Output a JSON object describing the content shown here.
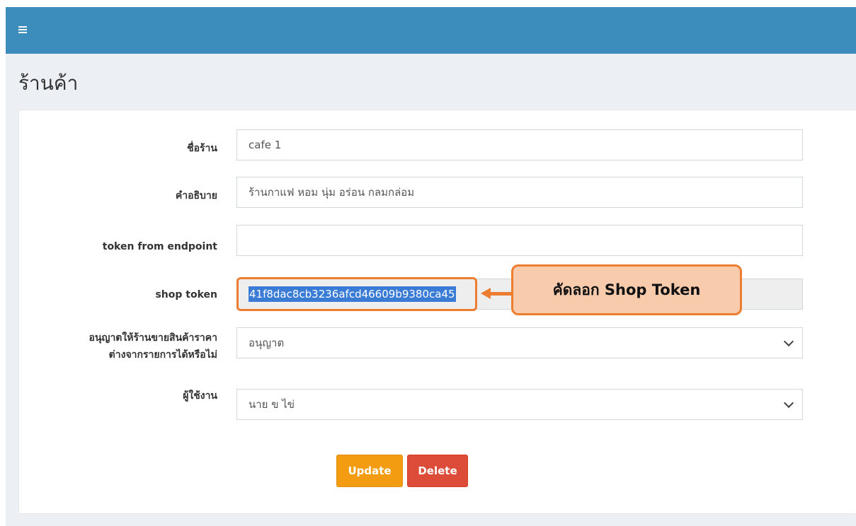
{
  "header": {
    "menu_icon": "hamburger-menu-icon",
    "color": "#3c8dbc"
  },
  "page": {
    "title": "ร้านค้า"
  },
  "form": {
    "shop_name": {
      "label": "ชื่อร้าน",
      "value": "cafe 1"
    },
    "description": {
      "label": "คำอธิบาย",
      "value": "ร้านกาแฟ หอม นุ่ม อร่อน กลมกล่อม"
    },
    "endpoint_token": {
      "label": "token from endpoint",
      "value": ""
    },
    "shop_token": {
      "label": "shop token",
      "value": "41f8dac8cb3236afcd46609b9380ca45"
    },
    "price_permission": {
      "label_line1": "อนุญาตให้ร้านขายสินค้าราคา",
      "label_line2": "ต่างจากรายการได้หรือไม่",
      "selected": "อนุญาต"
    },
    "user": {
      "label": "ผู้ใช้งาน",
      "selected": "นาย ข ไข่"
    }
  },
  "annotation": {
    "callout_text": "คัดลอก Shop Token",
    "color": "#ed7d31",
    "fill": "#f8cbad"
  },
  "actions": {
    "update_label": "Update",
    "delete_label": "Delete",
    "update_color": "#f39c12",
    "delete_color": "#dd4b39"
  }
}
